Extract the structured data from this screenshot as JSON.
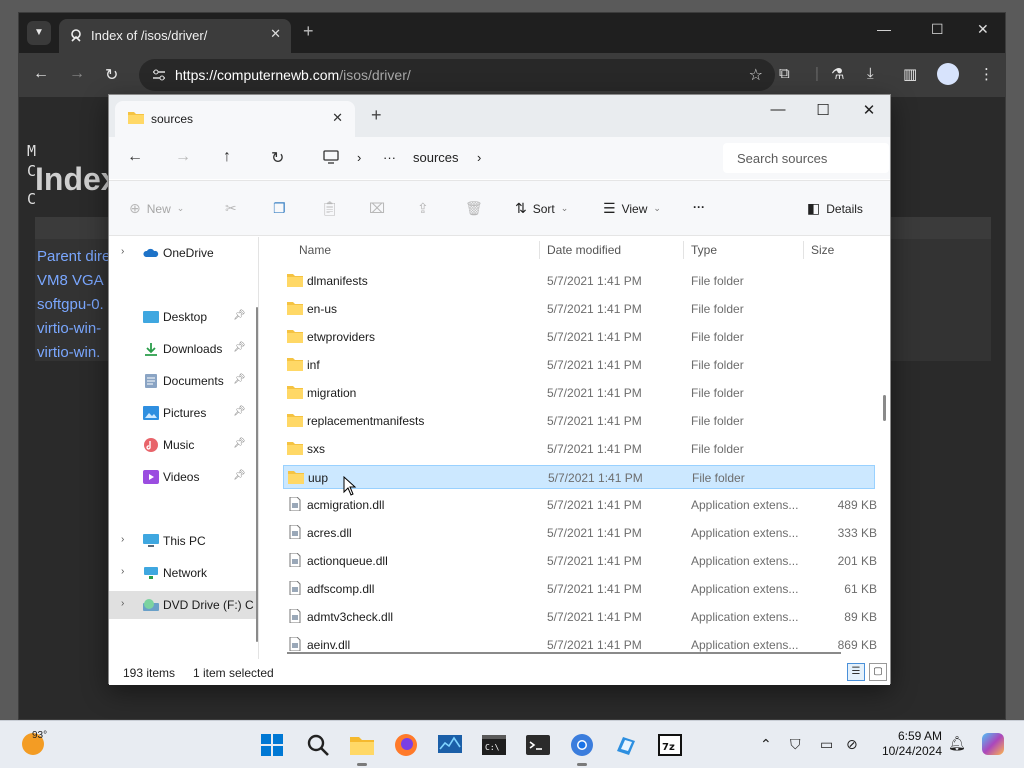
{
  "browser": {
    "tab_title": "Index of /isos/driver/",
    "url_host": "https://computernewb.com",
    "url_path": "/isos/driver/",
    "page": {
      "prefix_line1": "M",
      "prefix_line2": "C",
      "prefix_line3": "C",
      "heading": "Index",
      "links": [
        "Parent dire",
        "VM8 VGA",
        "softgpu-0.",
        "virtio-win-",
        "virtio-win."
      ]
    }
  },
  "explorer": {
    "tab_title": "sources",
    "breadcrumb": {
      "ellipsis": "···",
      "folder": "sources"
    },
    "search_placeholder": "Search sources",
    "commands": {
      "new": "New",
      "sort": "Sort",
      "view": "View",
      "more": "···",
      "details": "Details"
    },
    "nav": {
      "onedrive": "OneDrive",
      "desktop": "Desktop",
      "downloads": "Downloads",
      "documents": "Documents",
      "pictures": "Pictures",
      "music": "Music",
      "videos": "Videos",
      "thispc": "This PC",
      "network": "Network",
      "dvd": "DVD Drive (F:) C"
    },
    "columns": {
      "name": "Name",
      "date": "Date modified",
      "type": "Type",
      "size": "Size"
    },
    "files": [
      {
        "name": "dlmanifests",
        "date": "5/7/2021 1:41 PM",
        "type": "File folder",
        "size": "",
        "kind": "folder"
      },
      {
        "name": "en-us",
        "date": "5/7/2021 1:41 PM",
        "type": "File folder",
        "size": "",
        "kind": "folder"
      },
      {
        "name": "etwproviders",
        "date": "5/7/2021 1:41 PM",
        "type": "File folder",
        "size": "",
        "kind": "folder"
      },
      {
        "name": "inf",
        "date": "5/7/2021 1:41 PM",
        "type": "File folder",
        "size": "",
        "kind": "folder"
      },
      {
        "name": "migration",
        "date": "5/7/2021 1:41 PM",
        "type": "File folder",
        "size": "",
        "kind": "folder"
      },
      {
        "name": "replacementmanifests",
        "date": "5/7/2021 1:41 PM",
        "type": "File folder",
        "size": "",
        "kind": "folder"
      },
      {
        "name": "sxs",
        "date": "5/7/2021 1:41 PM",
        "type": "File folder",
        "size": "",
        "kind": "folder"
      },
      {
        "name": "uup",
        "date": "5/7/2021 1:41 PM",
        "type": "File folder",
        "size": "",
        "kind": "folder"
      },
      {
        "name": "acmigration.dll",
        "date": "5/7/2021 1:41 PM",
        "type": "Application extens...",
        "size": "489 KB",
        "kind": "file"
      },
      {
        "name": "acres.dll",
        "date": "5/7/2021 1:41 PM",
        "type": "Application extens...",
        "size": "333 KB",
        "kind": "file"
      },
      {
        "name": "actionqueue.dll",
        "date": "5/7/2021 1:41 PM",
        "type": "Application extens...",
        "size": "201 KB",
        "kind": "file"
      },
      {
        "name": "adfscomp.dll",
        "date": "5/7/2021 1:41 PM",
        "type": "Application extens...",
        "size": "61 KB",
        "kind": "file"
      },
      {
        "name": "admtv3check.dll",
        "date": "5/7/2021 1:41 PM",
        "type": "Application extens...",
        "size": "89 KB",
        "kind": "file"
      },
      {
        "name": "aeinv.dll",
        "date": "5/7/2021 1:41 PM",
        "type": "Application extens...",
        "size": "869 KB",
        "kind": "file"
      }
    ],
    "selected_file": "uup",
    "status": {
      "count": "193 items",
      "selected": "1 item selected"
    }
  },
  "taskbar": {
    "weather_temp": "93°",
    "time": "6:59 AM",
    "date": "10/24/2024"
  },
  "colors": {
    "selection": "#cce8ff",
    "folder": "#f5c342",
    "accent": "#0067c0"
  }
}
